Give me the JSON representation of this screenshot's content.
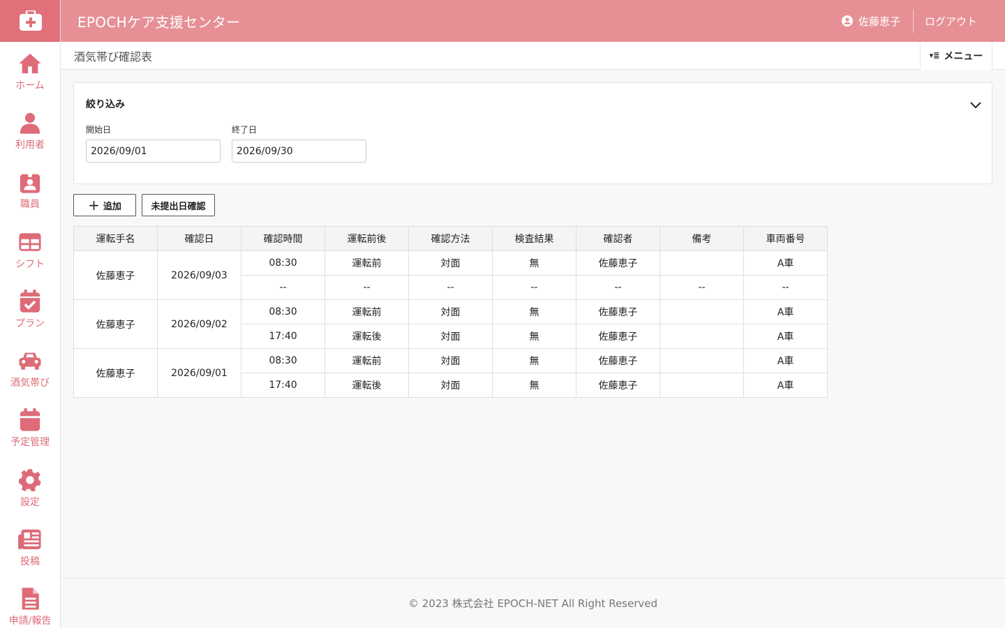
{
  "header": {
    "title": "EPOCHケア支援センター",
    "user_name": "佐藤恵子",
    "logout_label": "ログアウト"
  },
  "sidebar": {
    "items": [
      {
        "label": "ホーム",
        "icon": "home-icon"
      },
      {
        "label": "利用者",
        "icon": "user-icon"
      },
      {
        "label": "職員",
        "icon": "staff-badge-icon"
      },
      {
        "label": "シフト",
        "icon": "table-grid-icon"
      },
      {
        "label": "プラン",
        "icon": "calendar-check-icon"
      },
      {
        "label": "酒気帯び",
        "icon": "car-icon"
      },
      {
        "label": "予定管理",
        "icon": "calendar-icon"
      },
      {
        "label": "設定",
        "icon": "gear-icon"
      },
      {
        "label": "投稿",
        "icon": "newspaper-icon"
      },
      {
        "label": "申請/報告",
        "icon": "document-icon"
      }
    ]
  },
  "titlebar": {
    "page_title": "酒気帯び確認表",
    "menu_label": "メニュー"
  },
  "filter": {
    "title": "絞り込み",
    "start_label": "開始日",
    "start_value": "2026/09/01",
    "end_label": "終了日",
    "end_value": "2026/09/30"
  },
  "actions": {
    "add_label": "追加",
    "unsubmitted_label": "未提出日確認"
  },
  "table": {
    "headers": [
      "運転手名",
      "確認日",
      "確認時間",
      "運転前後",
      "確認方法",
      "検査結果",
      "確認者",
      "備考",
      "車両番号"
    ],
    "groups": [
      {
        "driver": "佐藤恵子",
        "date": "2026/09/03",
        "rows": [
          [
            "08:30",
            "運転前",
            "対面",
            "無",
            "佐藤恵子",
            "",
            "A車"
          ],
          [
            "--",
            "--",
            "--",
            "--",
            "--",
            "--",
            "--"
          ]
        ]
      },
      {
        "driver": "佐藤恵子",
        "date": "2026/09/02",
        "rows": [
          [
            "08:30",
            "運転前",
            "対面",
            "無",
            "佐藤恵子",
            "",
            "A車"
          ],
          [
            "17:40",
            "運転後",
            "対面",
            "無",
            "佐藤恵子",
            "",
            "A車"
          ]
        ]
      },
      {
        "driver": "佐藤恵子",
        "date": "2026/09/01",
        "rows": [
          [
            "08:30",
            "運転前",
            "対面",
            "無",
            "佐藤恵子",
            "",
            "A車"
          ],
          [
            "17:40",
            "運転後",
            "対面",
            "無",
            "佐藤恵子",
            "",
            "A車"
          ]
        ]
      }
    ]
  },
  "footer": {
    "text": "© 2023 株式会社 EPOCH-NET All Right Reserved"
  },
  "colors": {
    "brand": "#e69096",
    "brand_dark": "#e0707a",
    "icon": "#de6b78"
  }
}
